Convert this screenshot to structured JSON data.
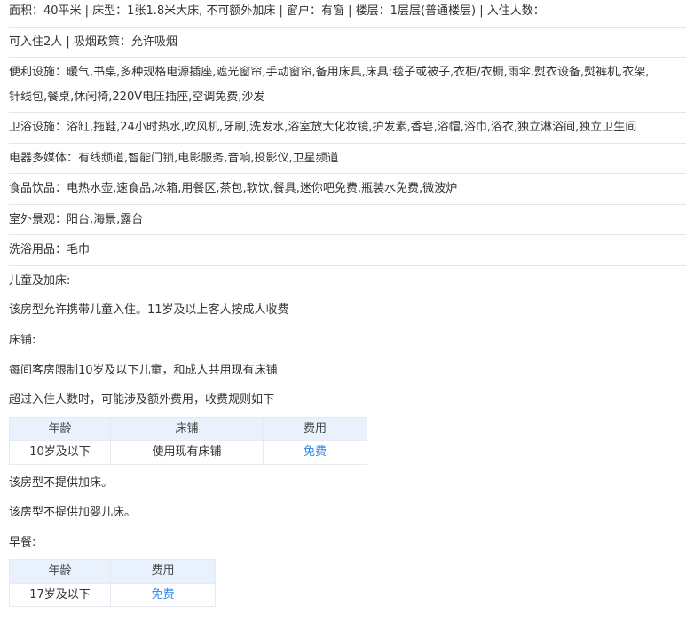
{
  "room_info": {
    "line1": "面积：40平米 | 床型：1张1.8米大床, 不可额外加床 | 窗户：有窗 | 楼层：1层层(普通楼层) | 入住人数：",
    "line2": "可入住2人 | 吸烟政策：允许吸烟"
  },
  "facilities": {
    "convenience_a": "便利设施：暖气,书桌,多种规格电源插座,遮光窗帘,手动窗帘,备用床具,床具:毯子或被子,衣柜/衣橱,雨伞,熨衣设备,熨裤机,衣架,",
    "convenience_b": "针线包,餐桌,休闲椅,220V电压插座,空调免费,沙发",
    "bathroom": "卫浴设施：浴缸,拖鞋,24小时热水,吹风机,牙刷,洗发水,浴室放大化妆镜,护发素,香皂,浴帽,浴巾,浴衣,独立淋浴间,独立卫生间",
    "media": "电器多媒体：有线频道,智能门锁,电影服务,音响,投影仪,卫星频道",
    "food": "食品饮品：电热水壶,速食品,冰箱,用餐区,茶包,软饮,餐具,迷你吧免费,瓶装水免费,微波炉",
    "view": "室外景观：阳台,海景,露台",
    "toiletries": "洗浴用品：毛巾"
  },
  "children": {
    "heading": "儿童及加床:",
    "policy": "该房型允许携带儿童入住。11岁及以上客人按成人收费",
    "bed_heading": "床铺:",
    "bed_policy": "每间客房限制10岁及以下儿童，和成人共用现有床铺",
    "extra_note": "超过入住人数时，可能涉及额外费用，收费规则如下",
    "bed_table": {
      "headers": [
        "年龄",
        "床铺",
        "费用"
      ],
      "rows": [
        [
          "10岁及以下",
          "使用现有床铺",
          "免费"
        ]
      ]
    },
    "no_extra_bed": "该房型不提供加床。",
    "no_crib": "该房型不提供加婴儿床。"
  },
  "breakfast": {
    "heading": "早餐:",
    "table": {
      "headers": [
        "年龄",
        "费用"
      ],
      "rows": [
        [
          "17岁及以下",
          "免费"
        ]
      ]
    }
  },
  "colors": {
    "accent": "#2d86e8",
    "table_header_bg": "#e9f1fd"
  }
}
